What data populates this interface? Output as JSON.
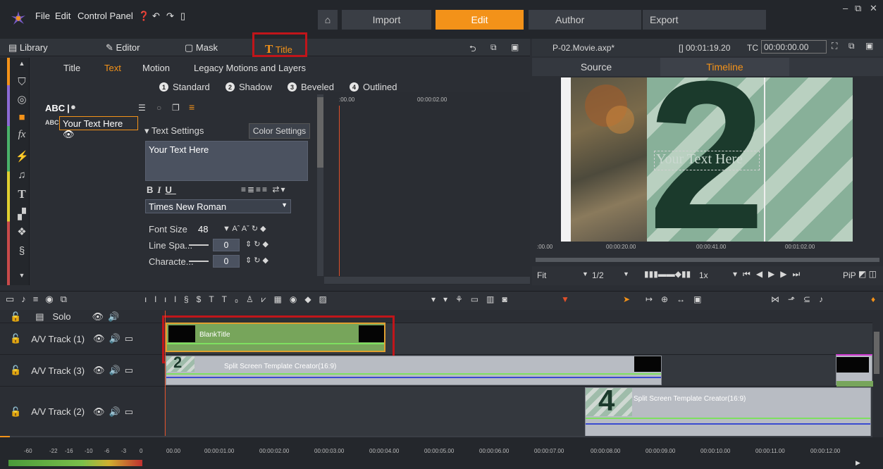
{
  "menu": {
    "file": "File",
    "edit": "Edit",
    "control_panel": "Control Panel"
  },
  "nav": {
    "import": "Import",
    "edit": "Edit",
    "author": "Author",
    "export": "Export"
  },
  "tabs": {
    "library": "Library",
    "editor": "Editor",
    "mask": "Mask",
    "title": "Title"
  },
  "subtabs": {
    "title": "Title",
    "text": "Text",
    "motion": "Motion",
    "legacy": "Legacy Motions and Layers"
  },
  "styles": [
    {
      "n": "1",
      "label": "Standard"
    },
    {
      "n": "2",
      "label": "Shadow"
    },
    {
      "n": "3",
      "label": "Beveled"
    },
    {
      "n": "4",
      "label": "Outlined"
    }
  ],
  "layer": {
    "abc": "ABC",
    "abc_small": "ABC",
    "name": "Your Text Here"
  },
  "text_settings": {
    "header": "Text Settings",
    "color_btn": "Color Settings",
    "text": "Your Text Here",
    "font": "Times New Roman",
    "font_size_label": "Font Size",
    "font_size": "48",
    "line_label": "Line Spa...",
    "line_val": "0",
    "char_label": "Characte...",
    "char_val": "0",
    "bold": "B",
    "italic": "I",
    "underline": "U"
  },
  "mini_ruler": {
    "t0": ":00.00",
    "t1": "00:00:02.00"
  },
  "preview": {
    "file": "P-02.Movie.axp*",
    "duration": "[] 00:01:19.20",
    "tc_label": "TC",
    "tc": "00:00:00.00",
    "source": "Source",
    "timeline": "Timeline",
    "overlay_text": "Your Text Here",
    "big_number": "2",
    "ruler": [
      ":00.00",
      "00:00:20.00",
      "00:00:41.00",
      "00:01:02.00"
    ],
    "fit": "Fit",
    "ratio": "1/2",
    "speed": "1x",
    "pip": "PiP"
  },
  "tracks": {
    "solo": "Solo",
    "t1": "A/V Track (1)",
    "t3": "A/V Track (3)",
    "t2": "A/V Track (2)"
  },
  "clips": {
    "blank": "BlankTitle",
    "split1": "Split Screen Template Creator(16:9)",
    "split2": "Split Screen Template Creator(16:9)",
    "num2": "2",
    "num4": "4"
  },
  "bottom_ruler": [
    "00.00",
    "00:00:01.00",
    "00:00:02.00",
    "00:00:03.00",
    "00:00:04.00",
    "00:00:05.00",
    "00:00:06.00",
    "00:00:07.00",
    "00:00:08.00",
    "00:00:09.00",
    "00:00:10.00",
    "00:00:11.00",
    "00:00:12.00"
  ],
  "meter": [
    "-60",
    "-22",
    "-16",
    "-10",
    "-6",
    "-3",
    "0"
  ],
  "colors": {
    "accent": "#f39219",
    "clip_green": "#77a55b",
    "highlight": "#c0151a"
  }
}
